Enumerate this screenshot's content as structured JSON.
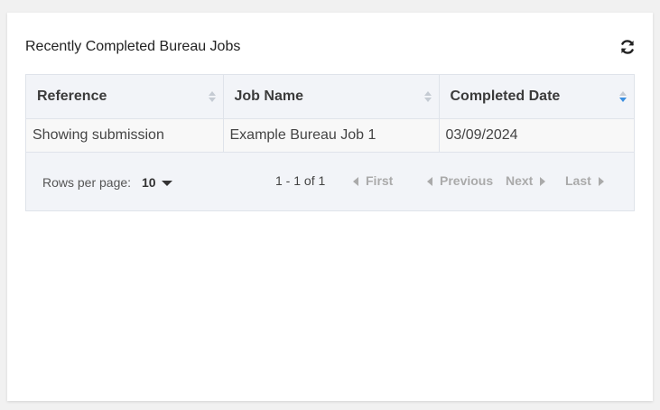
{
  "card": {
    "title": "Recently Completed Bureau Jobs",
    "refresh_icon": "refresh-icon"
  },
  "table": {
    "columns": [
      {
        "label": "Reference",
        "sort": "none"
      },
      {
        "label": "Job Name",
        "sort": "none"
      },
      {
        "label": "Completed Date",
        "sort": "descending"
      }
    ],
    "rows": [
      [
        "Showing submission",
        "Example Bureau Job 1",
        "03/09/2024"
      ]
    ]
  },
  "pagination": {
    "rows_per_page_label": "Rows per page:",
    "rows_per_page_value": "10",
    "range_text": "1 - 1 of 1",
    "first_label": "First",
    "previous_label": "Previous",
    "next_label": "Next",
    "last_label": "Last"
  },
  "colors": {
    "sort_active": "#3b8fe0",
    "sort_inactive": "#c5cbd3",
    "disabled_text": "#aaaaaa"
  }
}
